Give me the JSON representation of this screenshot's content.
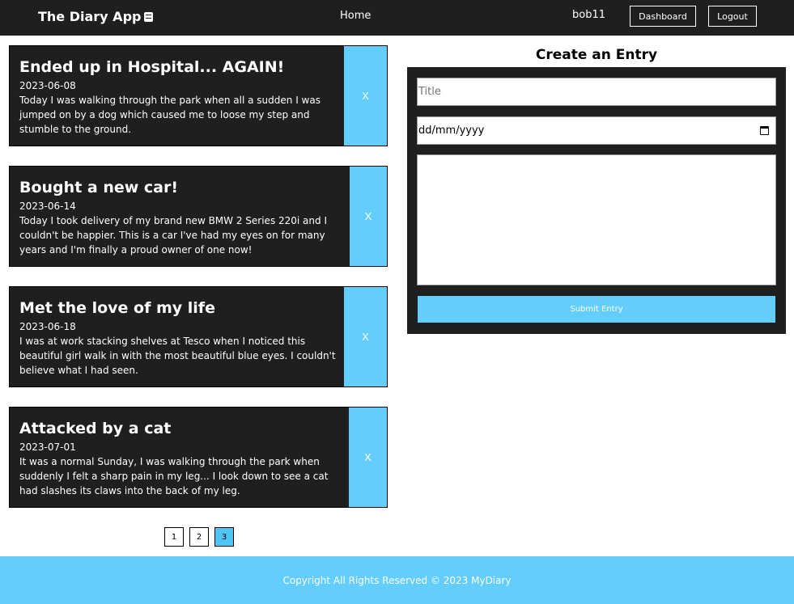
{
  "navbar": {
    "brand": "The Diary App",
    "brand_icon": "notebook-icon",
    "home_label": "Home",
    "username": "bob11",
    "dashboard_label": "Dashboard",
    "logout_label": "Logout"
  },
  "entries": [
    {
      "title": "Ended up in Hospital... AGAIN!",
      "date": "2023-06-08",
      "text": "Today I was walking through the park when all a sudden I was jumped on by a dog which caused me to loose my step and stumble to the ground.",
      "delete_label": "X"
    },
    {
      "title": "Bought a new car!",
      "date": "2023-06-14",
      "text": "Today I took delivery of my brand new BMW 2 Series 220i and I couldn't be happier. This is a car I've had my eyes on for many years and I'm finally a proud owner of one now!",
      "delete_label": "X"
    },
    {
      "title": "Met the love of my life",
      "date": "2023-06-18",
      "text": "I was at work stacking shelves at Tesco when I noticed this beautiful girl walk in with the most beautiful blue eyes. I couldn't believe what I had seen.",
      "delete_label": "X"
    },
    {
      "title": "Attacked by a cat",
      "date": "2023-07-01",
      "text": "It was a normal Sunday, I was walking through the park when suddenly I felt a sharp pain in my leg... I look down to see a cat had slashes its claws into the back of my leg.",
      "delete_label": "X"
    }
  ],
  "pagination": {
    "pages": [
      "1",
      "2",
      "3"
    ],
    "current": "3"
  },
  "form": {
    "heading": "Create an Entry",
    "title_placeholder": "Title",
    "date_placeholder": "dd/mm/yyyy",
    "body_value": "",
    "submit_label": "Submit Entry"
  },
  "footer": {
    "text": "Copyright All Rights Reserved © 2023 MyDiary"
  },
  "colors": {
    "accent": "#63cdfc",
    "dark": "#1f1f1f",
    "page_active": "#4ec5f4"
  }
}
